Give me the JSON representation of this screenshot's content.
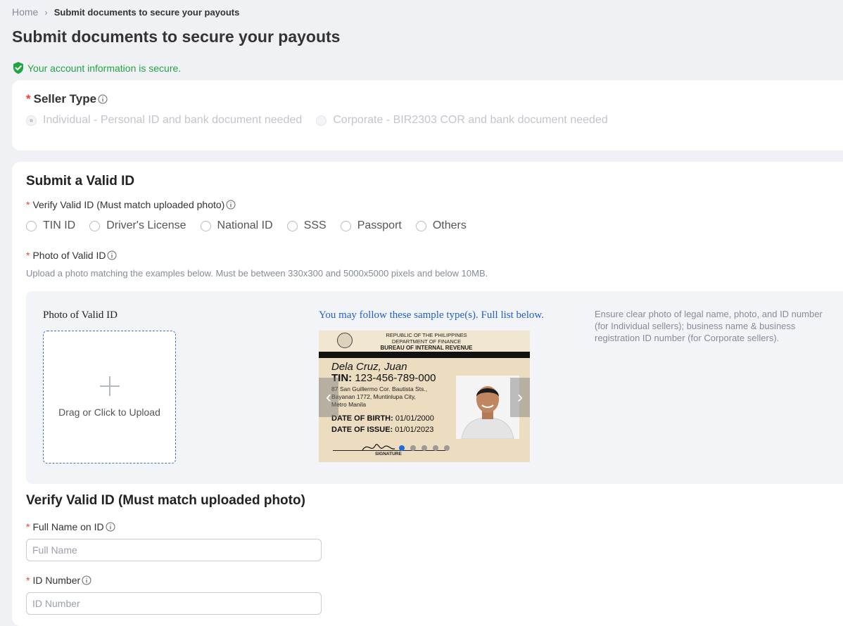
{
  "breadcrumb": {
    "home": "Home",
    "separator": "›",
    "current": "Submit documents to secure your payouts"
  },
  "page_title": "Submit documents to secure your payouts",
  "secure_notice": "Your account information is secure.",
  "seller_type": {
    "label": "Seller Type",
    "options": [
      {
        "label": "Individual - Personal ID and bank document needed",
        "selected": true,
        "disabled": true
      },
      {
        "label": "Corporate - BIR2303 COR and bank document needed",
        "selected": false,
        "disabled": true
      }
    ]
  },
  "valid_id_section": {
    "title": "Submit a Valid ID",
    "verify_label": "Verify Valid ID (Must match uploaded photo)",
    "id_types": [
      "TIN ID",
      "Driver's License",
      "National ID",
      "SSS",
      "Passport",
      "Others"
    ],
    "photo_label": "Photo of Valid ID",
    "hint": "Upload a photo matching the examples below. Must be between 330x300 and 5000x5000 pixels and below 10MB.",
    "upload": {
      "title": "Photo of Valid ID",
      "dropzone_text": "Drag or Click to Upload"
    },
    "sample": {
      "title": "You may follow these sample type(s). Full list below.",
      "card": {
        "header_line1": "REPUBLIC OF THE PHILIPPINES",
        "header_line2": "DEPARTMENT OF FINANCE",
        "header_line3": "BUREAU OF INTERNAL REVENUE",
        "name": "Dela Cruz, Juan",
        "tin_label": "TIN:",
        "tin_value": "123-456-789-000",
        "address_line1": "87 San Guillermo Cor. Bautista Sts.,",
        "address_line2": "Bayanan 1772, Muntinlupa City,",
        "address_line3": "Metro Manila",
        "dob_label": "DATE OF BIRTH:",
        "dob_value": "01/01/2000",
        "doi_label": "DATE OF ISSUE:",
        "doi_value": "01/01/2023",
        "signature_label": "SIGNATURE"
      },
      "carousel_total": 5,
      "carousel_active": 1
    },
    "guidance": "Ensure clear photo of legal name, photo, and ID number (for Individual sellers); business name & business registration ID number (for Corporate sellers)."
  },
  "verify_section": {
    "title": "Verify Valid ID (Must match uploaded photo)",
    "full_name_label": "Full Name on ID",
    "full_name_placeholder": "Full Name",
    "id_number_label": "ID Number",
    "id_number_placeholder": "ID Number"
  },
  "colors": {
    "accent_blue": "#1f5fd6",
    "required_red": "#f23c3c",
    "secure_green": "#20a541",
    "page_bg": "#f0f1f5"
  }
}
